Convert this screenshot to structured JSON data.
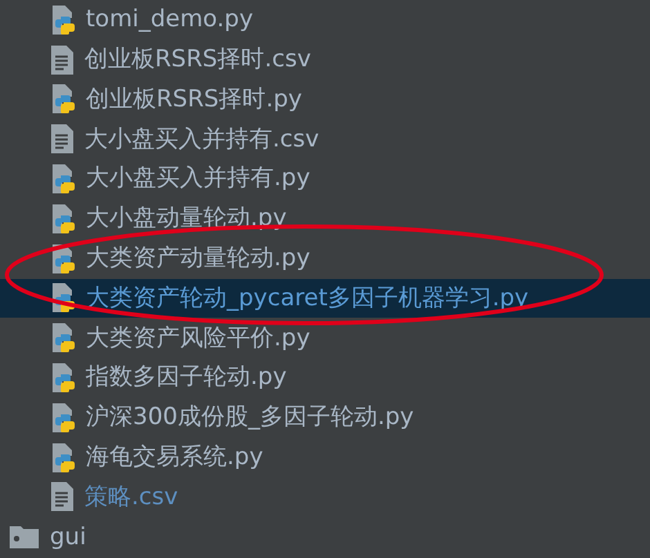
{
  "files": [
    {
      "name": "tomi_demo.py",
      "kind": "python",
      "selected": false,
      "color": "#a9b7c6"
    },
    {
      "name": "创业板RSRS择时.csv",
      "kind": "text",
      "selected": false,
      "color": "#a9b7c6"
    },
    {
      "name": "创业板RSRS择时.py",
      "kind": "python",
      "selected": false,
      "color": "#a9b7c6"
    },
    {
      "name": "大小盘买入并持有.csv",
      "kind": "text",
      "selected": false,
      "color": "#a9b7c6"
    },
    {
      "name": "大小盘买入并持有.py",
      "kind": "python",
      "selected": false,
      "color": "#a9b7c6"
    },
    {
      "name": "大小盘动量轮动.py",
      "kind": "python",
      "selected": false,
      "color": "#a9b7c6"
    },
    {
      "name": "大类资产动量轮动.py",
      "kind": "python",
      "selected": false,
      "color": "#a9b7c6"
    },
    {
      "name": "大类资产轮动_pycaret多因子机器学习.py",
      "kind": "python",
      "selected": true,
      "color": "#5a9bd5"
    },
    {
      "name": "大类资产风险平价.py",
      "kind": "python",
      "selected": false,
      "color": "#a9b7c6"
    },
    {
      "name": "指数多因子轮动.py",
      "kind": "python",
      "selected": false,
      "color": "#a9b7c6"
    },
    {
      "name": "沪深300成份股_多因子轮动.py",
      "kind": "python",
      "selected": false,
      "color": "#a9b7c6"
    },
    {
      "name": "海龟交易系统.py",
      "kind": "python",
      "selected": false,
      "color": "#a9b7c6"
    },
    {
      "name": "策略.csv",
      "kind": "text",
      "selected": false,
      "color": "#5d8fc0"
    }
  ],
  "folders": [
    {
      "name": "gui",
      "selected": false
    }
  ],
  "annotation": {
    "kind": "ellipse",
    "color": "#e0001a"
  }
}
